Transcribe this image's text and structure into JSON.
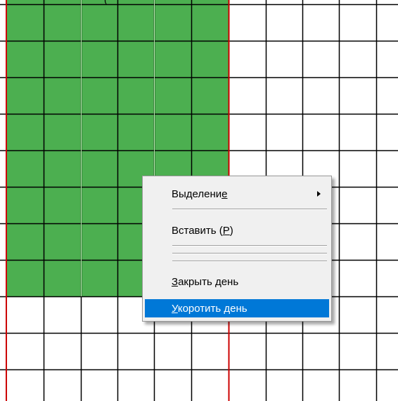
{
  "top_fragment": "(",
  "colors": {
    "cell_fill": "#4caf50",
    "grid_line": "#000000",
    "grid_line_light": "#b8e8b0",
    "red_line": "#cc0000",
    "menu_bg": "#f0f0f0",
    "menu_highlight": "#0078d7"
  },
  "grid": {
    "columns": 11,
    "rows": 11,
    "filled_columns": 6,
    "filled_rows": 8
  },
  "context_menu": {
    "items": [
      {
        "label_before": "Выделени",
        "mnemonic": "е",
        "label_after": "",
        "has_submenu": true,
        "selected": false
      },
      {
        "label_before": "Вставить (",
        "mnemonic": "Р",
        "label_after": ")",
        "has_submenu": false,
        "selected": false
      },
      {
        "label_before": "",
        "mnemonic": "З",
        "label_after": "акрыть день",
        "has_submenu": false,
        "selected": false
      },
      {
        "label_before": "",
        "mnemonic": "У",
        "label_after": "коротить день",
        "has_submenu": false,
        "selected": true
      }
    ]
  }
}
